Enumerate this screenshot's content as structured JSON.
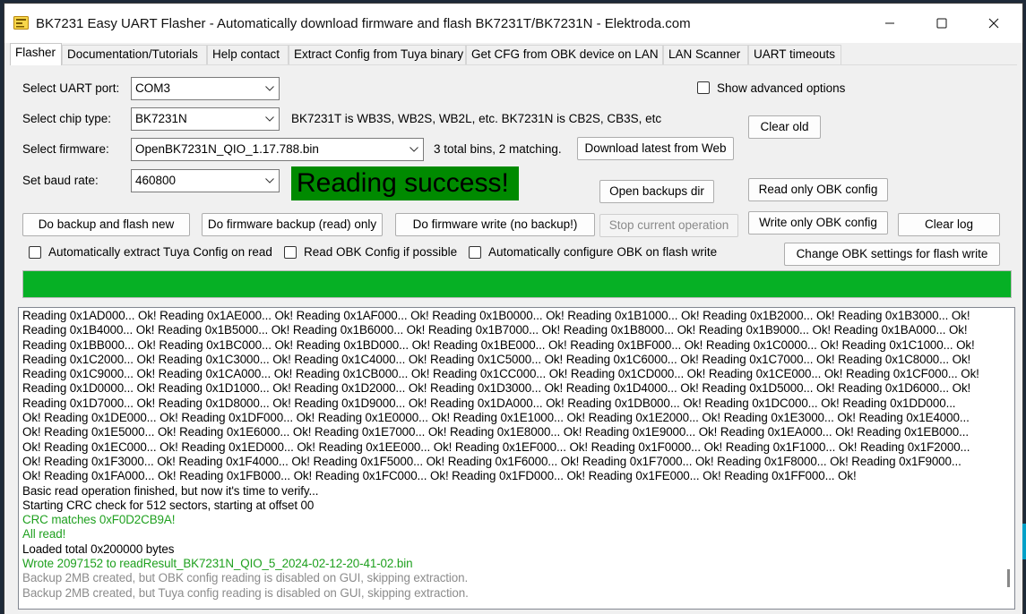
{
  "window": {
    "title": "BK7231 Easy UART Flasher - Automatically download firmware and flash BK7231T/BK7231N  - Elektroda.com",
    "controls": [
      "minimize",
      "maximize",
      "close"
    ]
  },
  "tabs": [
    {
      "label": "Flasher",
      "active": true
    },
    {
      "label": "Documentation/Tutorials"
    },
    {
      "label": "Help contact"
    },
    {
      "label": "Extract Config from Tuya binary"
    },
    {
      "label": "Get CFG from OBK device on LAN"
    },
    {
      "label": "LAN Scanner"
    },
    {
      "label": "UART timeouts"
    }
  ],
  "form": {
    "port_label": "Select UART port:",
    "port_value": "COM3",
    "chip_label": "Select chip type:",
    "chip_value": "BK7231N",
    "chip_note": "BK7231T is WB3S, WB2S, WB2L, etc. BK7231N is CB2S, CB3S, etc",
    "firmware_label": "Select firmware:",
    "firmware_value": "OpenBK7231N_QIO_1.17.788.bin",
    "bins_info": "3 total bins, 2 matching.",
    "baud_label": "Set baud rate:",
    "baud_value": "460800",
    "advanced_label": "Show advanced options",
    "status_text": "Reading success!"
  },
  "buttons": {
    "clear_old": "Clear old",
    "download_latest": "Download latest from Web",
    "open_backups": "Open backups dir",
    "read_obk": "Read only OBK config",
    "write_obk": "Write only OBK config",
    "clear_log": "Clear log",
    "backup_flash": "Do backup and flash new",
    "firmware_backup": "Do firmware backup (read) only",
    "firmware_write": "Do firmware write (no backup!)",
    "stop": "Stop current operation",
    "change_obk": "Change OBK settings for flash write"
  },
  "options": {
    "extract_tuya": "Automatically extract Tuya Config on read",
    "read_obk": "Read OBK Config if possible",
    "auto_configure": "Automatically configure OBK on flash write"
  },
  "progress": {
    "percent": 100
  },
  "colors": {
    "success": "#008a00",
    "progress": "#06b025",
    "log_green": "#1fa01f",
    "log_gray": "#8c8c8c"
  },
  "log": [
    {
      "text": "Reading 0x1AD000... Ok! Reading 0x1AE000... Ok! Reading 0x1AF000... Ok! Reading 0x1B0000... Ok! Reading 0x1B1000... Ok! Reading 0x1B2000... Ok! Reading 0x1B3000... Ok!",
      "color": "black"
    },
    {
      "text": "Reading 0x1B4000... Ok! Reading 0x1B5000... Ok! Reading 0x1B6000... Ok! Reading 0x1B7000... Ok! Reading 0x1B8000... Ok! Reading 0x1B9000... Ok! Reading 0x1BA000... Ok!",
      "color": "black"
    },
    {
      "text": "Reading 0x1BB000... Ok! Reading 0x1BC000... Ok! Reading 0x1BD000... Ok! Reading 0x1BE000... Ok! Reading 0x1BF000... Ok! Reading 0x1C0000... Ok! Reading 0x1C1000... Ok!",
      "color": "black"
    },
    {
      "text": "Reading 0x1C2000... Ok! Reading 0x1C3000... Ok! Reading 0x1C4000... Ok! Reading 0x1C5000... Ok! Reading 0x1C6000... Ok! Reading 0x1C7000... Ok! Reading 0x1C8000... Ok!",
      "color": "black"
    },
    {
      "text": "Reading 0x1C9000... Ok! Reading 0x1CA000... Ok! Reading 0x1CB000... Ok! Reading 0x1CC000... Ok! Reading 0x1CD000... Ok! Reading 0x1CE000... Ok! Reading 0x1CF000... Ok!",
      "color": "black"
    },
    {
      "text": "Reading 0x1D0000... Ok! Reading 0x1D1000... Ok! Reading 0x1D2000... Ok! Reading 0x1D3000... Ok! Reading 0x1D4000... Ok! Reading 0x1D5000... Ok! Reading 0x1D6000... Ok!",
      "color": "black"
    },
    {
      "text": "Reading 0x1D7000... Ok! Reading 0x1D8000... Ok! Reading 0x1D9000... Ok! Reading 0x1DA000... Ok! Reading 0x1DB000... Ok! Reading 0x1DC000... Ok! Reading 0x1DD000...",
      "color": "black"
    },
    {
      "text": "Ok! Reading 0x1DE000... Ok! Reading 0x1DF000... Ok! Reading 0x1E0000... Ok! Reading 0x1E1000... Ok! Reading 0x1E2000... Ok! Reading 0x1E3000... Ok! Reading 0x1E4000...",
      "color": "black"
    },
    {
      "text": "Ok! Reading 0x1E5000... Ok! Reading 0x1E6000... Ok! Reading 0x1E7000... Ok! Reading 0x1E8000... Ok! Reading 0x1E9000... Ok! Reading 0x1EA000... Ok! Reading 0x1EB000...",
      "color": "black"
    },
    {
      "text": "Ok! Reading 0x1EC000... Ok! Reading 0x1ED000... Ok! Reading 0x1EE000... Ok! Reading 0x1EF000... Ok! Reading 0x1F0000... Ok! Reading 0x1F1000... Ok! Reading 0x1F2000...",
      "color": "black"
    },
    {
      "text": "Ok! Reading 0x1F3000... Ok! Reading 0x1F4000... Ok! Reading 0x1F5000... Ok! Reading 0x1F6000... Ok! Reading 0x1F7000... Ok! Reading 0x1F8000... Ok! Reading 0x1F9000...",
      "color": "black"
    },
    {
      "text": "Ok! Reading 0x1FA000... Ok! Reading 0x1FB000... Ok! Reading 0x1FC000... Ok! Reading 0x1FD000... Ok! Reading 0x1FE000... Ok! Reading 0x1FF000... Ok!",
      "color": "black"
    },
    {
      "text": "Basic read operation finished, but now it's time to verify...",
      "color": "black"
    },
    {
      "text": "Starting CRC check for 512 sectors, starting at offset 00",
      "color": "black"
    },
    {
      "text": "CRC matches 0xF0D2CB9A!",
      "color": "green"
    },
    {
      "text": "All read!",
      "color": "green"
    },
    {
      "text": "Loaded total 0x200000 bytes",
      "color": "black"
    },
    {
      "text": "Wrote 2097152 to readResult_BK7231N_QIO_5_2024-02-12-20-41-02.bin",
      "color": "green"
    },
    {
      "text": "Backup 2MB created, but OBK config reading is disabled on GUI, skipping extraction.",
      "color": "gray"
    },
    {
      "text": "Backup 2MB created, but Tuya config reading is disabled on GUI, skipping extraction.",
      "color": "gray"
    }
  ]
}
